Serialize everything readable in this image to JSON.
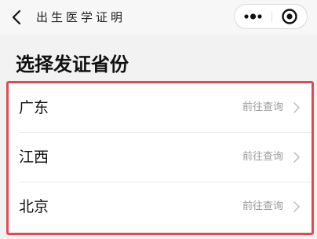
{
  "nav": {
    "title": "出生医学证明",
    "back_icon": "chevron-left-icon",
    "more_icon": "more-dots-icon",
    "close_icon": "target-close-icon"
  },
  "page": {
    "heading": "选择发证省份"
  },
  "provinces": [
    {
      "name": "广东",
      "action": "前往查询"
    },
    {
      "name": "江西",
      "action": "前往查询"
    },
    {
      "name": "北京",
      "action": "前往查询"
    }
  ],
  "colors": {
    "highlight_border": "#e04a55",
    "secondary_text": "#9a9a9a",
    "page_background": "#f2f2f2"
  }
}
